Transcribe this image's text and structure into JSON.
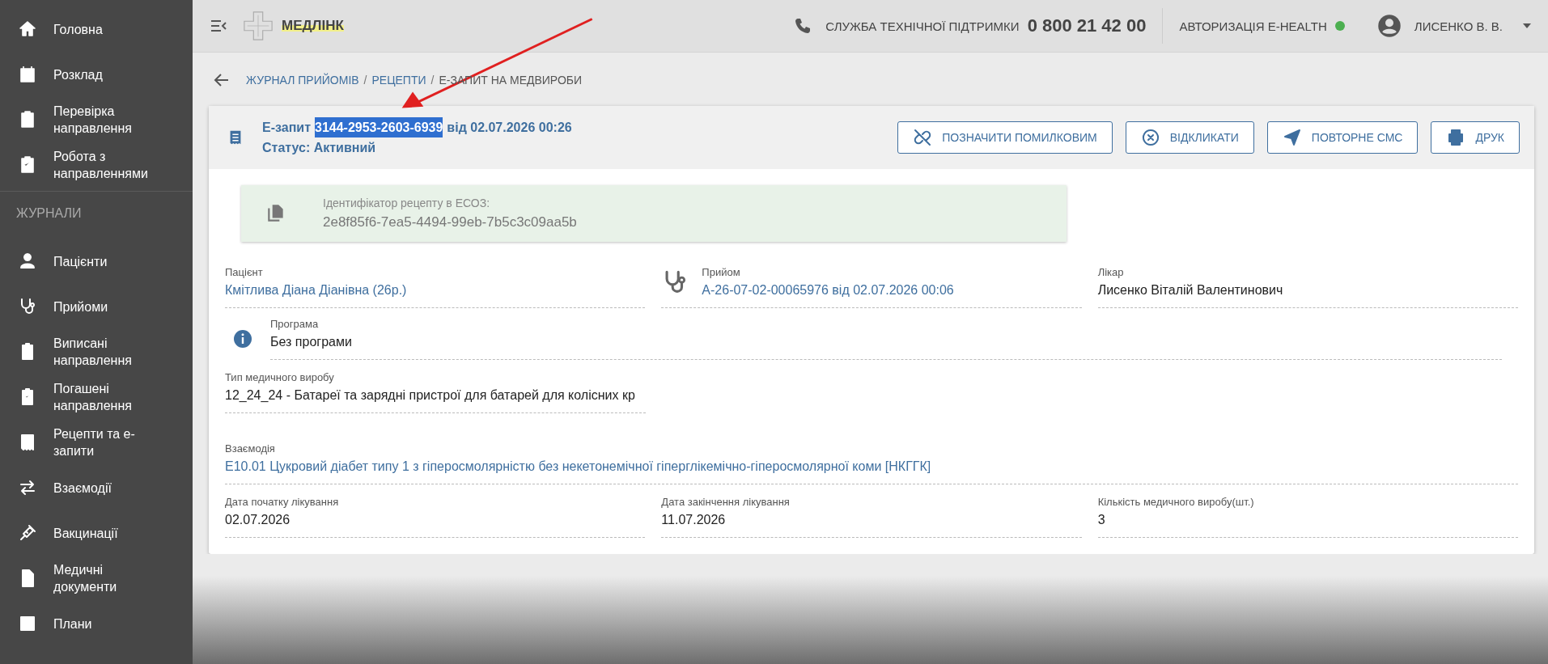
{
  "sidebar": {
    "top_items": [
      {
        "label": "Головна"
      },
      {
        "label": "Розклад"
      },
      {
        "label": "Перевірка направлення"
      },
      {
        "label": "Робота з направленнями"
      }
    ],
    "section_title": "ЖУРНАЛИ",
    "journal_items": [
      {
        "label": "Пацієнти"
      },
      {
        "label": "Прийоми"
      },
      {
        "label": "Виписані направлення"
      },
      {
        "label": "Погашені направлення"
      },
      {
        "label": "Рецепти та е-запити"
      },
      {
        "label": "Взаємодії"
      },
      {
        "label": "Вакцинації"
      },
      {
        "label": "Медичні документи"
      },
      {
        "label": "Плани"
      }
    ]
  },
  "header": {
    "logo": "МЕДЛІНК",
    "support_label": "СЛУЖБА ТЕХНІЧНОЇ ПІДТРИМКИ",
    "support_phone": "0 800 21 42 00",
    "auth_label": "АВТОРИЗАЦІЯ E-HEALTH",
    "auth_connected": true,
    "user_name": "ЛИСЕНКО В. В."
  },
  "breadcrumbs": [
    {
      "label": "ЖУРНАЛ ПРИЙОМІВ",
      "current": false
    },
    {
      "separator": "/",
      "label": "РЕЦЕПТИ",
      "current": false
    },
    {
      "separator": "/",
      "label": "Е-ЗАПИТ НА МЕДВИРОБИ",
      "current": true
    }
  ],
  "request": {
    "title_prefix": "Е-запит",
    "number": "3144-2953-2603-6939",
    "number_highlighted": true,
    "title_suffix": "від 02.07.2026 00:26",
    "status": "Статус: Активний"
  },
  "actions": [
    {
      "label": "ПОЗНАЧИТИ ПОМИЛКОВИМ"
    },
    {
      "label": "ВІДКЛИКАТИ"
    },
    {
      "label": "ПОВТОРНЕ СМС"
    },
    {
      "label": "ДРУК"
    }
  ],
  "ehealth_id": {
    "label": "Ідентифікатор рецепту в ЕСОЗ:",
    "value": "2e8f85f6-7ea5-4494-99eb-7b5c3c09aa5b"
  },
  "fields": {
    "patient": {
      "label": "Пацієнт",
      "value": "Кмітлива Діана Діанівна (26р.)",
      "link": true
    },
    "appointment": {
      "label": "Прийом",
      "value": "А-26-07-02-00065976 від 02.07.2026 00:06",
      "link": true
    },
    "doctor": {
      "label": "Лікар",
      "value": "Лисенко Віталій Валентинович",
      "link": false
    },
    "program": {
      "label": "Програма",
      "value": "Без програми",
      "link": false
    },
    "device_type": {
      "label": "Тип медичного виробу",
      "value": "12_24_24 - Батареї та зарядні пристрої для батарей для колісних кр",
      "link": false
    },
    "interaction": {
      "label": "Взаємодія",
      "value": "E10.01 Цукровий діабет типу 1 з гіперосмолярністю без некетонемічної гіперглікемічно-гіперосмолярної коми [НКГГК]",
      "link": true
    },
    "start_date": {
      "label": "Дата початку лікування",
      "value": "02.07.2026",
      "link": false
    },
    "end_date": {
      "label": "Дата закінчення лікування",
      "value": "11.07.2026",
      "link": false
    },
    "quantity": {
      "label": "Кількість медичного виробу(шт.)",
      "value": "3",
      "link": false
    }
  }
}
